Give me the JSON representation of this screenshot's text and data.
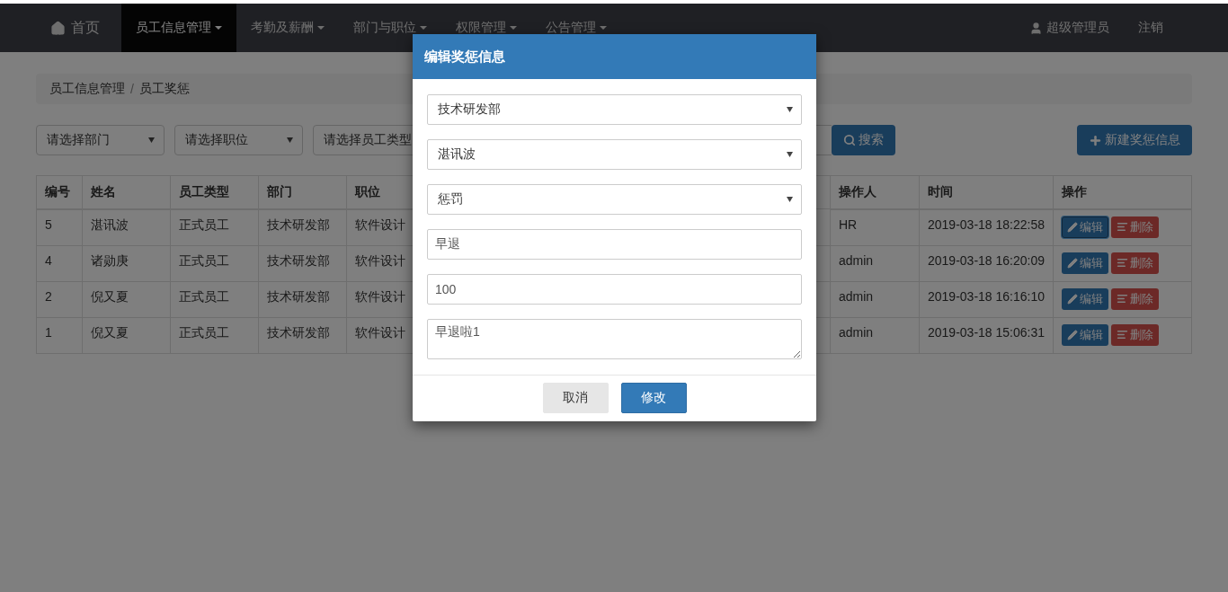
{
  "nav": {
    "home": "首页",
    "menus": [
      {
        "label": "员工信息管理",
        "selected": true
      },
      {
        "label": "考勤及薪酬",
        "selected": false
      },
      {
        "label": "部门与职位",
        "selected": false
      },
      {
        "label": "权限管理",
        "selected": false
      },
      {
        "label": "公告管理",
        "selected": false
      }
    ],
    "user": "超级管理员",
    "logout": "注销"
  },
  "breadcrumb": [
    "员工信息管理",
    "员工奖惩"
  ],
  "breadcrumb_separator": "/",
  "filters": [
    "请选择部门",
    "请选择职位",
    "请选择员工类型"
  ],
  "search_button": "搜索",
  "new_button": "新建奖惩信息",
  "table": {
    "columns": [
      "编号",
      "姓名",
      "员工类型",
      "部门",
      "职位",
      "操作人",
      "时间",
      "操作"
    ],
    "rows": [
      {
        "cells": [
          "5",
          "湛讯波",
          "正式员工",
          "技术研发部",
          "软件设计"
        ],
        "operator": "HR",
        "time": "2019-03-18 18:22:58",
        "edit": "编辑",
        "delete": "删除",
        "focused": true
      },
      {
        "cells": [
          "4",
          "诸勋庚",
          "正式员工",
          "技术研发部",
          "软件设计"
        ],
        "operator": "admin",
        "time": "2019-03-18 16:20:09",
        "edit": "编辑",
        "delete": "删除",
        "focused": false
      },
      {
        "cells": [
          "2",
          "倪又夏",
          "正式员工",
          "技术研发部",
          "软件设计"
        ],
        "operator": "admin",
        "time": "2019-03-18 16:16:10",
        "edit": "编辑",
        "delete": "删除",
        "focused": false
      },
      {
        "cells": [
          "1",
          "倪又夏",
          "正式员工",
          "技术研发部",
          "软件设计"
        ],
        "operator": "admin",
        "time": "2019-03-18 15:06:31",
        "edit": "编辑",
        "delete": "删除",
        "focused": false
      }
    ]
  },
  "modal": {
    "title": "编辑奖惩信息",
    "fields": [
      {
        "kind": "select",
        "value": "技术研发部"
      },
      {
        "kind": "select",
        "value": "湛讯波"
      },
      {
        "kind": "select",
        "value": "惩罚"
      },
      {
        "kind": "input",
        "value": "早退"
      },
      {
        "kind": "input",
        "value": "100"
      },
      {
        "kind": "textarea",
        "value": "早退啦1"
      }
    ],
    "buttons": [
      {
        "label": "取消",
        "kind": "default"
      },
      {
        "label": "修改",
        "kind": "primary"
      }
    ]
  }
}
